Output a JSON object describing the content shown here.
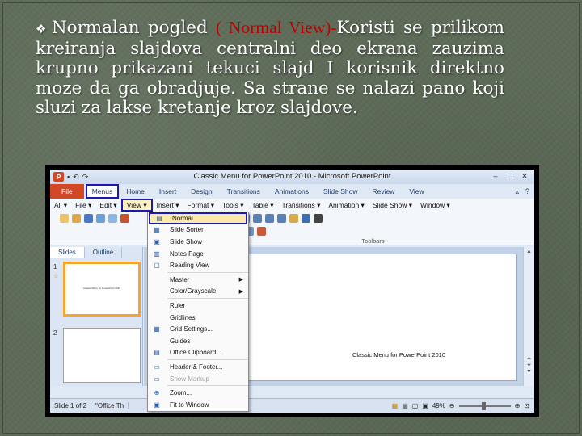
{
  "slide": {
    "bullet": "❖",
    "text_before": "Normalan pogled ",
    "highlight": "( Normal View)-",
    "text_after": "Koristi se prilikom kreiranja slajdova centralni deo ekrana zauzima krupno prikazani tekuci slajd I korisnik direktno moze da ga obradjuje. Sa strane se nalazi pano koji sluzi za lakse kretanje kroz slajdove."
  },
  "app": {
    "title": "Classic Menu for PowerPoint 2010  -  Microsoft PowerPoint",
    "logo": "P",
    "ribbon_tabs": [
      "File",
      "Menus",
      "Home",
      "Insert",
      "Design",
      "Transitions",
      "Animations",
      "Slide Show",
      "Review",
      "View"
    ],
    "menu_items": [
      "All ▾",
      "File ▾",
      "Edit ▾",
      "View ▾",
      "Insert ▾",
      "Format ▾",
      "Tools ▾",
      "Table ▾",
      "Transitions ▾",
      "Animation ▾",
      "Slide Show ▾",
      "Window ▾"
    ],
    "toolbars_label": "Toolbars",
    "panel_tabs": [
      "Slides",
      "Outline"
    ],
    "thumb_numbers": [
      "1",
      "2"
    ],
    "thumb_text": "Classic Menu for PowerPoint 2010",
    "slide_caption": "Classic Menu for PowerPoint 2010",
    "status": {
      "slide": "Slide 1 of 2",
      "theme": "\"Office Th",
      "zoom": "49%"
    },
    "dropdown": [
      {
        "label": "Normal",
        "icon": "▤"
      },
      {
        "label": "Slide Sorter",
        "icon": "▦"
      },
      {
        "label": "Slide Show",
        "icon": "▣"
      },
      {
        "label": "Notes Page",
        "icon": "▥"
      },
      {
        "label": "Reading View",
        "icon": "▢"
      },
      {
        "label": "Master",
        "icon": ""
      },
      {
        "label": "Color/Grayscale",
        "icon": ""
      },
      {
        "label": "Ruler",
        "icon": ""
      },
      {
        "label": "Gridlines",
        "icon": ""
      },
      {
        "label": "Grid Settings...",
        "icon": "▦"
      },
      {
        "label": "Guides",
        "icon": ""
      },
      {
        "label": "Office Clipboard...",
        "icon": "▤"
      },
      {
        "label": "Header & Footer...",
        "icon": "▭"
      },
      {
        "label": "Show Markup",
        "icon": "▭"
      },
      {
        "label": "Zoom...",
        "icon": "⊕"
      },
      {
        "label": "Fit to Window",
        "icon": "▣"
      }
    ]
  }
}
